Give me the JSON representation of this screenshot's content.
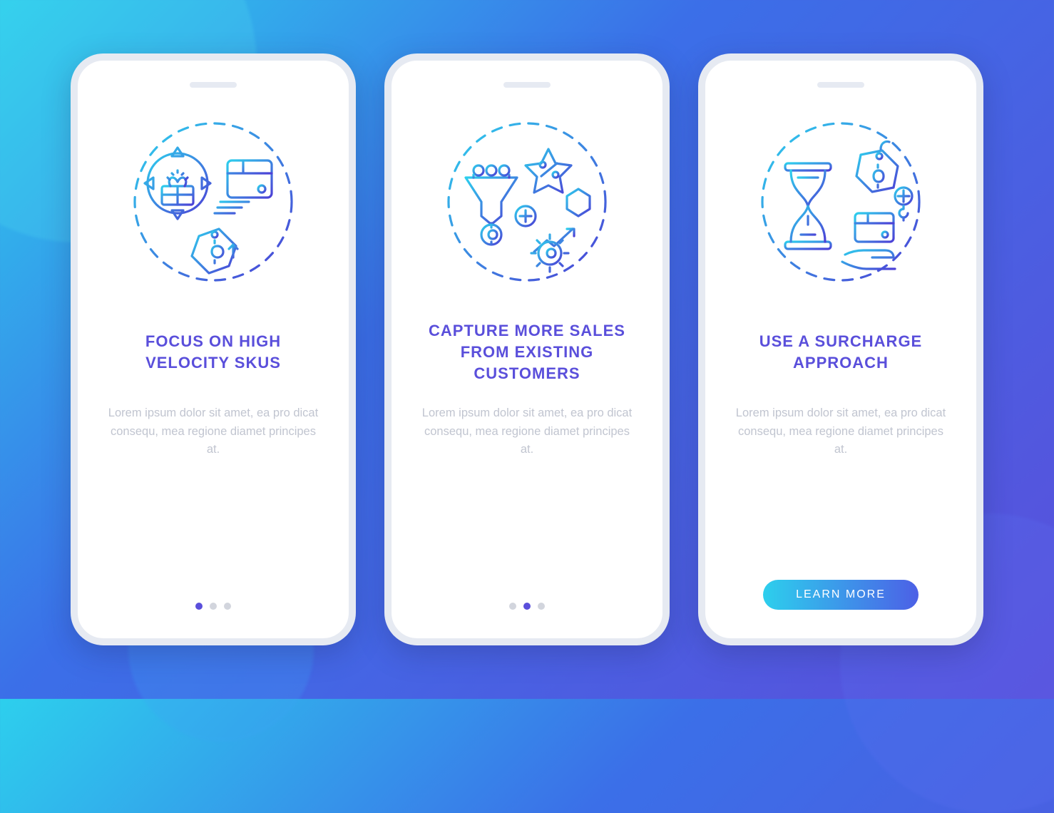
{
  "screens": [
    {
      "title": "FOCUS ON HIGH VELOCITY SKUS",
      "body": "Lorem ipsum dolor sit amet, ea pro dicat consequ, mea regione diamet principes at.",
      "icon": "target-box-price-icon",
      "footer": {
        "type": "dots",
        "active_index": 0,
        "count": 3
      }
    },
    {
      "title": "CAPTURE MORE SALES FROM EXISTING CUSTOMERS",
      "body": "Lorem ipsum dolor sit amet, ea pro dicat consequ, mea regione diamet principes at.",
      "icon": "funnel-growth-icon",
      "footer": {
        "type": "dots",
        "active_index": 1,
        "count": 3
      }
    },
    {
      "title": "USE A SURCHARGE APPROACH",
      "body": "Lorem ipsum dolor sit amet, ea pro dicat consequ, mea regione diamet principes at.",
      "icon": "hourglass-surcharge-icon",
      "footer": {
        "type": "button",
        "label": "LEARN MORE"
      }
    }
  ],
  "colors": {
    "gradient_stroke_start": "#2DCFED",
    "gradient_stroke_end": "#4C3FD6",
    "title": "#5A4FDB",
    "placeholder": "#C1C5D0"
  }
}
